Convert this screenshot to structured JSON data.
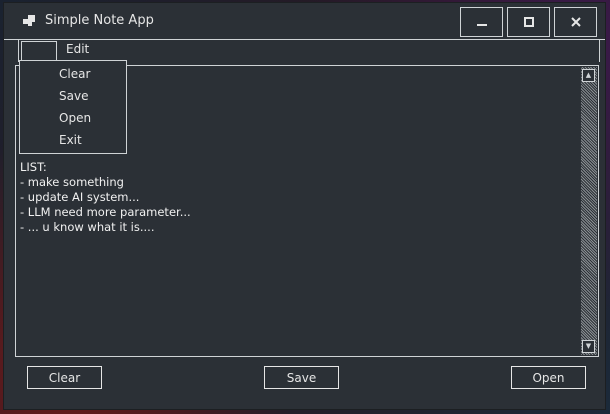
{
  "window": {
    "title": "Simple Note App"
  },
  "menu": {
    "edit_label": "Edit"
  },
  "dropdown": {
    "items": [
      "Clear",
      "Save",
      "Open",
      "Exit"
    ]
  },
  "editor": {
    "content": "LIST:\n- make something\n- update AI system...\n- LLM need more parameter...\n- ... u know what it is...."
  },
  "buttons": {
    "clear": "Clear",
    "save": "Save",
    "open": "Open"
  },
  "icons": {
    "app": "window-grid-icon",
    "minimize": "minimize-icon",
    "maximize": "maximize-icon",
    "close": "close-icon"
  }
}
